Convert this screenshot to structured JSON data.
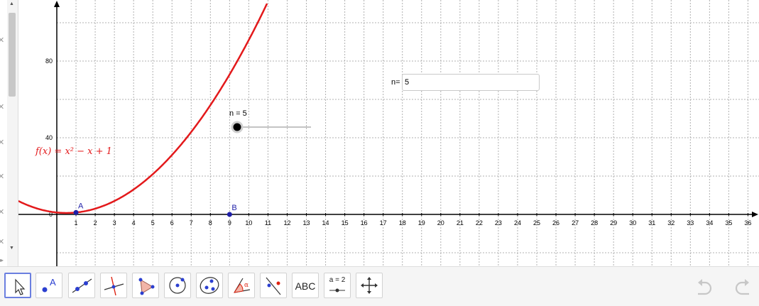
{
  "graph": {
    "function_label": "f(x) = x² − x + 1",
    "point_a": "A",
    "point_b": "B",
    "x_ticks": [
      "1",
      "2",
      "3",
      "4",
      "5",
      "6",
      "7",
      "8",
      "9",
      "10",
      "11",
      "12",
      "13",
      "14",
      "15",
      "16",
      "17",
      "18",
      "19",
      "20",
      "21",
      "22",
      "23",
      "24",
      "25",
      "26",
      "27",
      "28",
      "29",
      "30",
      "31",
      "32",
      "33",
      "34",
      "35",
      "36"
    ],
    "y_ticks": [
      "0",
      "40",
      "80"
    ],
    "colors": {
      "function": "#e3191b",
      "point": "#1e1ea8",
      "grid": "#b0b0b0",
      "axis": "#000000"
    }
  },
  "slider": {
    "label": "n = 5",
    "value": 5
  },
  "input_box": {
    "caption": "n=",
    "value": "5"
  },
  "toolbar": {
    "tools": [
      {
        "icon": "move-arrow-icon"
      },
      {
        "icon": "point-icon",
        "label": "A"
      },
      {
        "icon": "line-icon"
      },
      {
        "icon": "perpendicular-icon"
      },
      {
        "icon": "polygon-icon"
      },
      {
        "icon": "circle-center-icon"
      },
      {
        "icon": "conic-icon"
      },
      {
        "icon": "angle-icon"
      },
      {
        "icon": "reflect-icon"
      },
      {
        "icon": "text-tool",
        "label": "ABC"
      },
      {
        "icon": "slider-tool",
        "label": "a = 2"
      },
      {
        "icon": "move-view-icon"
      }
    ]
  }
}
